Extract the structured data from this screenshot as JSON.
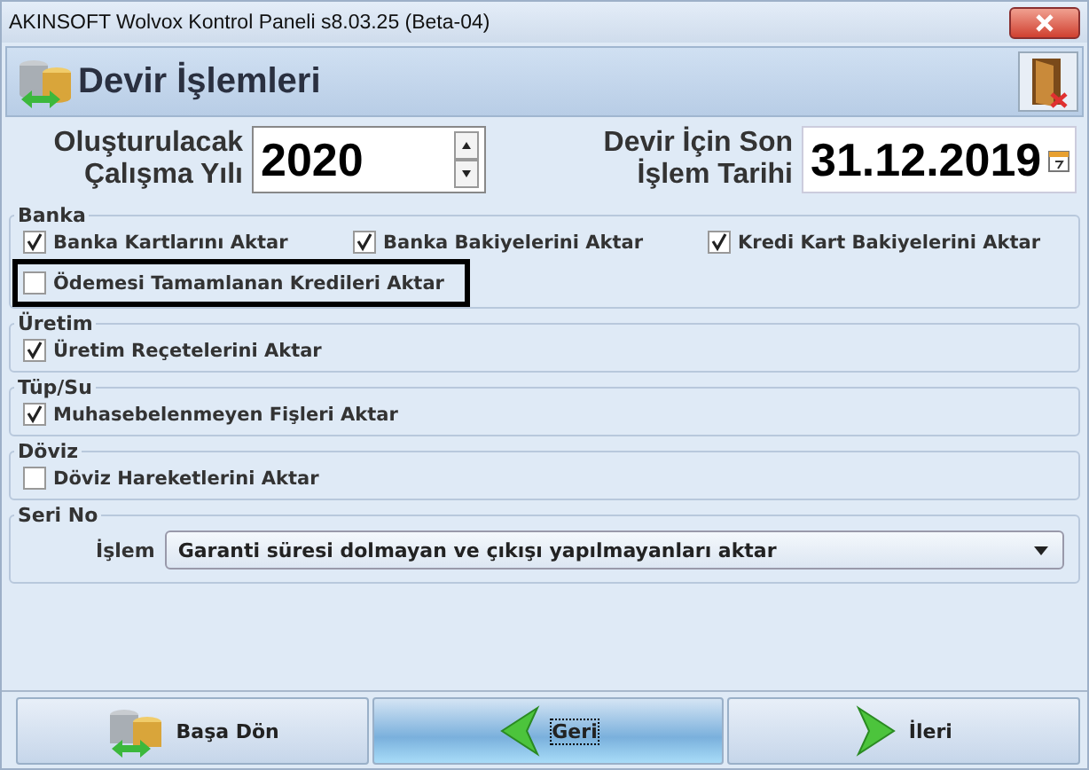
{
  "window": {
    "title": "AKINSOFT Wolvox Kontrol Paneli s8.03.25 (Beta-04)"
  },
  "header": {
    "title": "Devir İşlemleri"
  },
  "fields": [
    {
      "label": "Oluşturulacak Çalışma Yılı",
      "value": "2020",
      "kind": "spin"
    },
    {
      "label": "Devir İçin Son İşlem Tarihi",
      "value": "31.12.2019",
      "kind": "date"
    }
  ],
  "groups": [
    {
      "title": "Banka",
      "items": [
        {
          "label": "Banka Kartlarını Aktar",
          "checked": true,
          "highlighted": false
        },
        {
          "label": "Banka Bakiyelerini Aktar",
          "checked": true,
          "highlighted": false
        },
        {
          "label": "Kredi Kart Bakiyelerini Aktar",
          "checked": true,
          "highlighted": false
        },
        {
          "label": "Ödemesi Tamamlanan Kredileri Aktar",
          "checked": false,
          "highlighted": true
        }
      ]
    },
    {
      "title": "Üretim",
      "items": [
        {
          "label": "Üretim Reçetelerini Aktar",
          "checked": true,
          "highlighted": false
        }
      ]
    },
    {
      "title": "Tüp/Su",
      "items": [
        {
          "label": "Muhasebelenmeyen Fişleri Aktar",
          "checked": true,
          "highlighted": false
        }
      ]
    },
    {
      "title": "Döviz",
      "items": [
        {
          "label": "Döviz Hareketlerini Aktar",
          "checked": false,
          "highlighted": false
        }
      ]
    }
  ],
  "serial": {
    "title": "Seri No",
    "label": "İşlem",
    "value": "Garanti süresi dolmayan ve çıkışı yapılmayanları aktar"
  },
  "buttons": [
    {
      "label": "Başa Dön",
      "kind": "db",
      "selected": false
    },
    {
      "label": "Geri",
      "kind": "back",
      "selected": true
    },
    {
      "label": "İleri",
      "kind": "next",
      "selected": false
    }
  ]
}
